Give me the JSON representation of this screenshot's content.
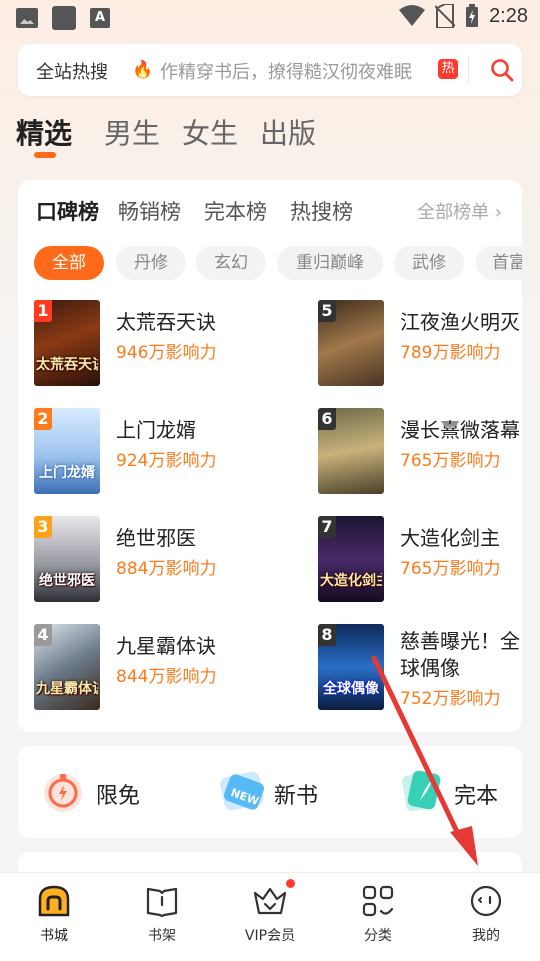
{
  "status_bar": {
    "time": "2:28",
    "notif_letter": "A"
  },
  "search": {
    "hot_label": "全站热搜",
    "placeholder": "作精穿书后，撩得糙汉彻夜难眠",
    "hot_badge": "热"
  },
  "top_tabs": [
    {
      "label": "精选",
      "active": true
    },
    {
      "label": "男生",
      "active": false
    },
    {
      "label": "女生",
      "active": false
    },
    {
      "label": "出版",
      "active": false
    }
  ],
  "rank_tabs": [
    {
      "label": "口碑榜",
      "active": true
    },
    {
      "label": "畅销榜",
      "active": false
    },
    {
      "label": "完本榜",
      "active": false
    },
    {
      "label": "热搜榜",
      "active": false
    }
  ],
  "rank_all": "全部榜单 ›",
  "chips": [
    {
      "label": "全部",
      "active": true
    },
    {
      "label": "丹修",
      "active": false
    },
    {
      "label": "玄幻",
      "active": false
    },
    {
      "label": "重归巅峰",
      "active": false
    },
    {
      "label": "武修",
      "active": false
    },
    {
      "label": "首富",
      "active": false
    }
  ],
  "books": [
    {
      "rank": "1",
      "title": "太荒吞天诀",
      "influence": "946万影响力",
      "cover_text": "太荒吞天诀"
    },
    {
      "rank": "2",
      "title": "上门龙婿",
      "influence": "924万影响力",
      "cover_text": "上门龙婿"
    },
    {
      "rank": "3",
      "title": "绝世邪医",
      "influence": "884万影响力",
      "cover_text": "绝世邪医"
    },
    {
      "rank": "4",
      "title": "九星霸体诀",
      "influence": "844万影响力",
      "cover_text": "九星霸体诀"
    },
    {
      "rank": "5",
      "title": "江夜渔火明灭",
      "influence": "789万影响力",
      "cover_text": ""
    },
    {
      "rank": "6",
      "title": "漫长熹微落幕",
      "influence": "765万影响力",
      "cover_text": ""
    },
    {
      "rank": "7",
      "title": "大造化剑主",
      "influence": "765万影响力",
      "cover_text": "大造化剑主"
    },
    {
      "rank": "8",
      "title": "慈善曝光！全球偶像",
      "influence": "752万影响力",
      "cover_text": "全球偶像"
    }
  ],
  "features": [
    {
      "label": "限免",
      "icon": "stopwatch-icon"
    },
    {
      "label": "新书",
      "icon": "new-tag-icon"
    },
    {
      "label": "完本",
      "icon": "book-feather-icon"
    }
  ],
  "bottom_nav": [
    {
      "label": "书城",
      "icon": "bookstore-icon",
      "active": true
    },
    {
      "label": "书架",
      "icon": "bookshelf-icon",
      "active": false
    },
    {
      "label": "VIP会员",
      "icon": "vip-crown-icon",
      "active": false
    },
    {
      "label": "分类",
      "icon": "category-grid-icon",
      "active": false
    },
    {
      "label": "我的",
      "icon": "profile-face-icon",
      "active": false
    }
  ],
  "colors": {
    "accent": "#ff6a1a",
    "influence": "#ff7a1a",
    "badge_red": "#ff3b30",
    "annotation_arrow": "#e53935"
  }
}
